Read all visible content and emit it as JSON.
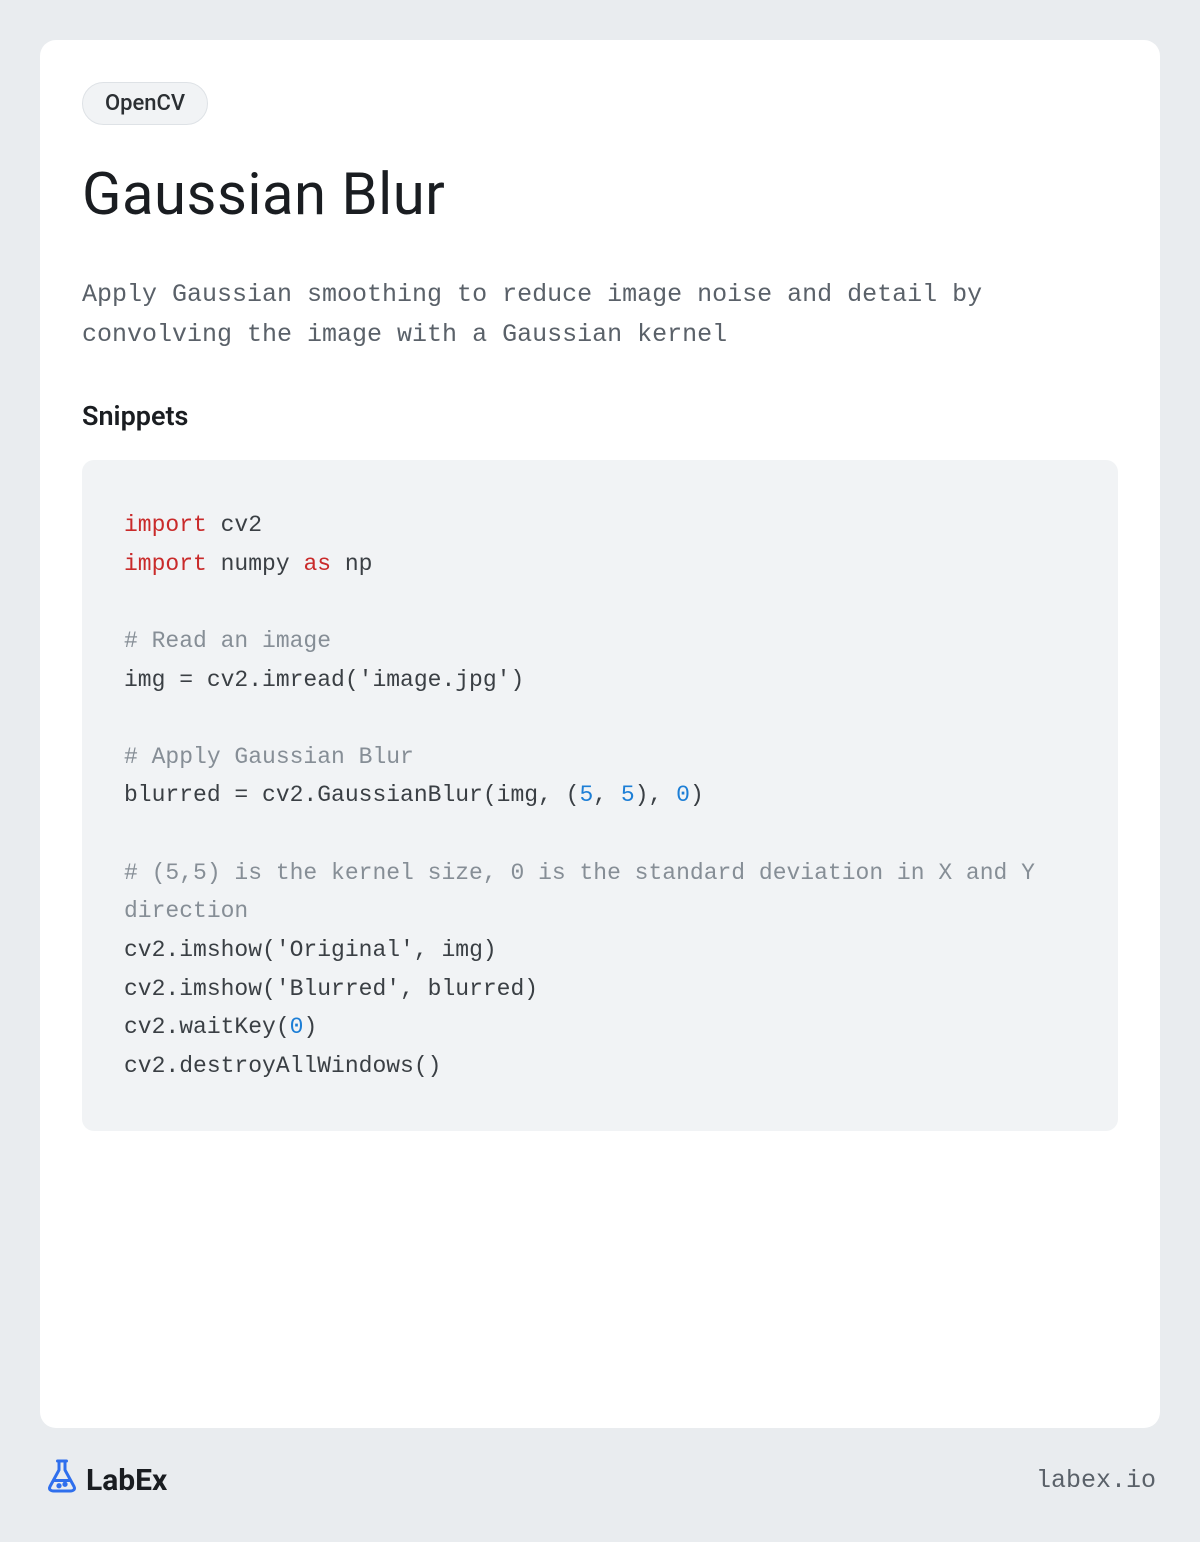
{
  "tag": "OpenCV",
  "title": "Gaussian Blur",
  "description": "Apply Gaussian smoothing to reduce image noise and detail by convolving the image with a Gaussian kernel",
  "snippets_heading": "Snippets",
  "code": {
    "tokens": [
      {
        "t": "import",
        "c": "kw"
      },
      {
        "t": " cv2\n",
        "c": "nm"
      },
      {
        "t": "import",
        "c": "kw"
      },
      {
        "t": " numpy ",
        "c": "nm"
      },
      {
        "t": "as",
        "c": "kw"
      },
      {
        "t": " np\n",
        "c": "nm"
      },
      {
        "t": "\n",
        "c": "nm"
      },
      {
        "t": "# Read an image\n",
        "c": "cm"
      },
      {
        "t": "img = cv2.imread(",
        "c": "nm"
      },
      {
        "t": "'image.jpg'",
        "c": "st"
      },
      {
        "t": ")\n",
        "c": "nm"
      },
      {
        "t": "\n",
        "c": "nm"
      },
      {
        "t": "# Apply Gaussian Blur\n",
        "c": "cm"
      },
      {
        "t": "blurred = cv2.GaussianBlur(img, (",
        "c": "nm"
      },
      {
        "t": "5",
        "c": "num"
      },
      {
        "t": ", ",
        "c": "nm"
      },
      {
        "t": "5",
        "c": "num"
      },
      {
        "t": "), ",
        "c": "nm"
      },
      {
        "t": "0",
        "c": "num"
      },
      {
        "t": ")\n",
        "c": "nm"
      },
      {
        "t": "\n",
        "c": "nm"
      },
      {
        "t": "# (5,5) is the kernel size, 0 is the standard deviation in X and Y direction\n",
        "c": "cm"
      },
      {
        "t": "cv2.imshow(",
        "c": "nm"
      },
      {
        "t": "'Original'",
        "c": "st"
      },
      {
        "t": ", img)\n",
        "c": "nm"
      },
      {
        "t": "cv2.imshow(",
        "c": "nm"
      },
      {
        "t": "'Blurred'",
        "c": "st"
      },
      {
        "t": ", blurred)\n",
        "c": "nm"
      },
      {
        "t": "cv2.waitKey(",
        "c": "nm"
      },
      {
        "t": "0",
        "c": "num"
      },
      {
        "t": ")\n",
        "c": "nm"
      },
      {
        "t": "cv2.destroyAllWindows()",
        "c": "nm"
      }
    ]
  },
  "footer": {
    "brand": "LabEx",
    "site": "labex.io"
  }
}
